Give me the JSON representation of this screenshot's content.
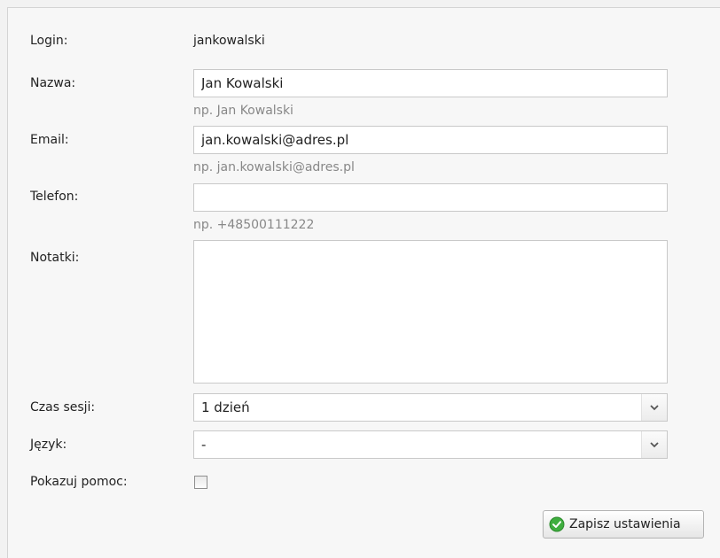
{
  "form": {
    "login": {
      "label": "Login:",
      "value": "jankowalski"
    },
    "name": {
      "label": "Nazwa:",
      "value": "Jan Kowalski",
      "hint": "np. Jan Kowalski"
    },
    "email": {
      "label": "Email:",
      "value": "jan.kowalski@adres.pl",
      "hint": "np. jan.kowalski@adres.pl"
    },
    "phone": {
      "label": "Telefon:",
      "value": "",
      "hint": "np. +48500111222"
    },
    "notes": {
      "label": "Notatki:",
      "value": ""
    },
    "session": {
      "label": "Czas sesji:",
      "selected": "1 dzień"
    },
    "language": {
      "label": "Język:",
      "selected": "-"
    },
    "help": {
      "label": "Pokazuj pomoc:",
      "checked": false
    }
  },
  "actions": {
    "save_label": "Zapisz ustawienia"
  },
  "icons": {
    "save": "check-circle-icon",
    "dropdown": "chevron-down-icon"
  },
  "colors": {
    "save_icon": "#3fae3f",
    "hint_text": "#888888"
  }
}
